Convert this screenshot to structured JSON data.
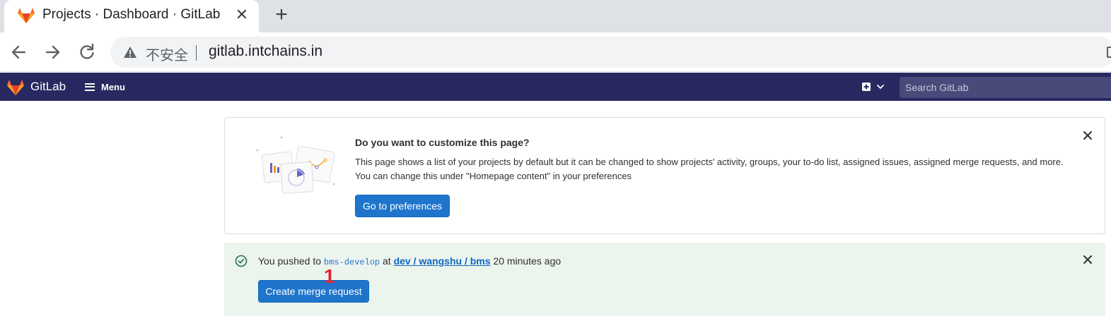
{
  "browser": {
    "tab_title": "Projects · Dashboard · GitLab",
    "tab_close": "✕",
    "new_tab": "+",
    "insecure_label": "不安全",
    "url": "gitlab.intchains.in",
    "icons": [
      "back-arrow-icon",
      "forward-arrow-icon",
      "reload-icon",
      "warning-icon",
      "gitlab-favicon"
    ]
  },
  "header": {
    "brand": "GitLab",
    "menu_label": "Menu",
    "search_placeholder": "Search GitLab",
    "header_color": "#292961"
  },
  "customize_card": {
    "heading": "Do you want to customize this page?",
    "description": "This page shows a list of your projects by default but it can be changed to show projects' activity, groups, your to-do list, assigned issues, assigned merge requests, and more. You can change this under \"Homepage content\" in your preferences",
    "button_label": "Go to preferences"
  },
  "push_alert": {
    "prefix": "You pushed to ",
    "branch": "bms-develop",
    "at": " at ",
    "project": "dev / wangshu / bms",
    "time": " 20 minutes ago",
    "button_label": "Create merge request",
    "background": "#ecf4ee"
  },
  "annotation": {
    "marker": "1",
    "color": "#e3262d"
  },
  "colors": {
    "primary_button": "#1f75cb",
    "tabstrip": "#dee1e6"
  }
}
